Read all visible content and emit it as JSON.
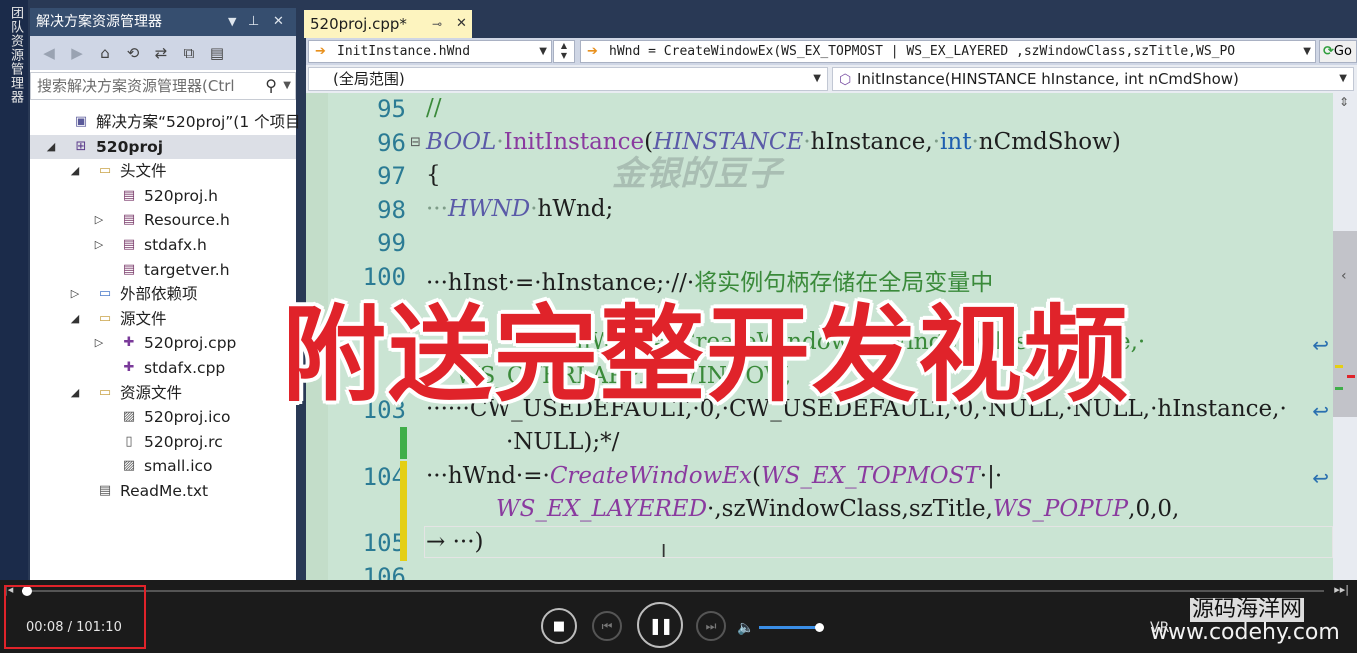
{
  "left_strip": {
    "tab_label": "团队资源管理器"
  },
  "solution_explorer": {
    "title": "解决方案资源管理器",
    "title_controls": {
      "dropdown": "▼",
      "pin": "📌",
      "close": "✕"
    },
    "search_placeholder": "搜索解决方案资源管理器(Ctrl",
    "tree": [
      {
        "label": "解决方案“520proj”(1 个项目",
        "icon": "solution-icon",
        "indent": 0,
        "arrow": "",
        "bold": false,
        "selected": false
      },
      {
        "label": "520proj",
        "icon": "project-icon",
        "indent": 1,
        "arrow": "◢",
        "bold": true,
        "selected": true
      },
      {
        "label": "头文件",
        "icon": "folder-icon",
        "indent": 2,
        "arrow": "◢",
        "bold": false,
        "selected": false
      },
      {
        "label": "520proj.h",
        "icon": "header-file-icon",
        "indent": 3,
        "arrow": "",
        "bold": false,
        "selected": false
      },
      {
        "label": "Resource.h",
        "icon": "header-file-icon",
        "indent": 3,
        "arrow": "▷",
        "bold": false,
        "selected": false
      },
      {
        "label": "stdafx.h",
        "icon": "header-file-icon",
        "indent": 3,
        "arrow": "▷",
        "bold": false,
        "selected": false
      },
      {
        "label": "targetver.h",
        "icon": "header-file-icon",
        "indent": 3,
        "arrow": "",
        "bold": false,
        "selected": false
      },
      {
        "label": "外部依赖项",
        "icon": "dependency-folder-icon",
        "indent": 2,
        "arrow": "▷",
        "bold": false,
        "selected": false
      },
      {
        "label": "源文件",
        "icon": "folder-icon",
        "indent": 2,
        "arrow": "◢",
        "bold": false,
        "selected": false
      },
      {
        "label": "520proj.cpp",
        "icon": "cpp-file-icon",
        "indent": 3,
        "arrow": "▷",
        "bold": false,
        "selected": false
      },
      {
        "label": "stdafx.cpp",
        "icon": "cpp-file-icon",
        "indent": 3,
        "arrow": "",
        "bold": false,
        "selected": false
      },
      {
        "label": "资源文件",
        "icon": "folder-icon",
        "indent": 2,
        "arrow": "◢",
        "bold": false,
        "selected": false
      },
      {
        "label": "520proj.ico",
        "icon": "image-file-icon",
        "indent": 3,
        "arrow": "",
        "bold": false,
        "selected": false
      },
      {
        "label": "520proj.rc",
        "icon": "resource-file-icon",
        "indent": 3,
        "arrow": "",
        "bold": false,
        "selected": false
      },
      {
        "label": "small.ico",
        "icon": "image-file-icon",
        "indent": 3,
        "arrow": "",
        "bold": false,
        "selected": false
      },
      {
        "label": "ReadMe.txt",
        "icon": "text-file-icon",
        "indent": 2,
        "arrow": "",
        "bold": false,
        "selected": false
      }
    ]
  },
  "editor": {
    "tab_label": "520proj.cpp*",
    "tab_pin": "⊸",
    "tab_close": "✕",
    "nav_left": "InitInstance.hWnd",
    "nav_right": "hWnd = CreateWindowEx(WS_EX_TOPMOST | WS_EX_LAYERED ,szWindowClass,szTitle,WS_PO",
    "go_label": "Go",
    "scope_left": "(全局范围)",
    "scope_right": "InitInstance(HINSTANCE hInstance, int nCmdShow)",
    "line_numbers": [
      "95",
      "96",
      "97",
      "98",
      "99",
      "100",
      "103",
      "104",
      "105",
      "106"
    ],
    "code": {
      "l95": "//",
      "l96_kw": "BOOL",
      "l96_fn": "InitInstance",
      "l96_ty1": "HINSTANCE",
      "l96_p1": "hInstance,",
      "l96_kw2": "int",
      "l96_p2": "nCmdShow)",
      "l96_open": "(",
      "l97": "{",
      "l98_dots": "···",
      "l98_ty": "HWND",
      "l98_rest": "hWnd;",
      "l100_code": "···hInst·=·hInstance;·//·",
      "l100_cm": "将实例句柄存储在全局变量中",
      "l101_frag": "hWnd·=·CreateWindow(szWindowClass,·szTitle,·",
      "l102_frag": "WS_OVERLAPPEDWINDOW,",
      "l103": "······CW_USEDEFAULT,·0,·CW_USEDEFAULT,·0,·NULL,·NULL,·hInstance,·",
      "l103b": "·NULL);*/",
      "l104_pre": "···hWnd·=·",
      "l104_fn": "CreateWindowEx",
      "l104_ty": "WS_EX_TOPMOST",
      "l104_tail": "·|·",
      "l104b_ty": "WS_EX_LAYERED",
      "l104b_rest": "·,szWindowClass,szTitle,",
      "l104b_ty2": "WS_POPUP",
      "l104b_end": ",0,0,",
      "l105": "→    ···)",
      "l96_collapse": "⊟"
    },
    "watermark": "金银的豆子",
    "overlay_text": "附送完整开发视频"
  },
  "player": {
    "time": "00:08 / 101:10",
    "progress": 0.001,
    "volume": 0.9,
    "stop": "■",
    "prev": "⏮",
    "pause": "❚❚",
    "next": "⏭",
    "vol_icon": "🔈",
    "edge_left": "|◂",
    "edge_right": "▸▸|",
    "brand_cn": "源码海洋网",
    "brand_url": "www.codehy.com",
    "ctrl_vr": "VR"
  }
}
